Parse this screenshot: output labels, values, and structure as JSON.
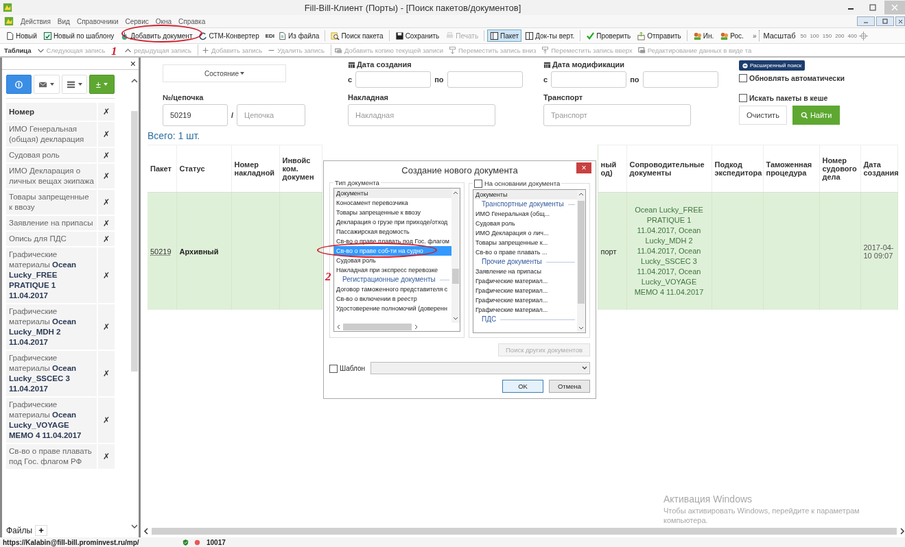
{
  "window": {
    "title": "Fill-Bill-Клиент (Порты) - [Поиск пакетов/документов]"
  },
  "menu": [
    "Действия",
    "Вид",
    "Справочники",
    "Сервис",
    "Окна",
    "Справка"
  ],
  "toolbar": [
    {
      "kind": "button",
      "label": "Новый",
      "disabled": false,
      "selected": false
    },
    {
      "kind": "button",
      "label": "Новый по шаблону",
      "disabled": false,
      "selected": false
    },
    {
      "kind": "button",
      "label": "Добавить документ",
      "disabled": false,
      "selected": false
    },
    {
      "kind": "button",
      "label": "СТМ-Конвертер",
      "disabled": false,
      "selected": false
    },
    {
      "kind": "button",
      "badge": "EDI",
      "label": "Из файла",
      "disabled": false,
      "selected": false
    },
    {
      "kind": "separator"
    },
    {
      "kind": "button",
      "label": "Поиск пакета",
      "disabled": false,
      "selected": false
    },
    {
      "kind": "separator"
    },
    {
      "kind": "button",
      "label": "Сохранить",
      "disabled": false,
      "selected": false
    },
    {
      "kind": "button",
      "label": "Печать",
      "disabled": true,
      "selected": false
    },
    {
      "kind": "separator"
    },
    {
      "kind": "button",
      "label": "Пакет",
      "disabled": false,
      "selected": true
    },
    {
      "kind": "button",
      "label": "Док-ты верт.",
      "disabled": false,
      "selected": false
    },
    {
      "kind": "separator"
    },
    {
      "kind": "button",
      "label": "Проверить",
      "disabled": false,
      "selected": false
    },
    {
      "kind": "button",
      "label": "Отправить",
      "disabled": false,
      "selected": false
    },
    {
      "kind": "separator"
    },
    {
      "kind": "button",
      "label": "Ин.",
      "disabled": false,
      "selected": false
    },
    {
      "kind": "button",
      "label": "Рос.",
      "disabled": false,
      "selected": false
    }
  ],
  "toolbar_overflow": "»",
  "zoom": {
    "label": "Масштаб",
    "steps": [
      "50",
      "100",
      "150",
      "200",
      "400"
    ]
  },
  "table_toolbar": [
    {
      "label": "Таблица"
    },
    {
      "label": "Следующая запись",
      "disabled": true
    },
    {
      "label": "редыдущая запись",
      "disabled": true
    },
    {
      "kind": "separator"
    },
    {
      "label": "Добавить запись",
      "disabled": true
    },
    {
      "label": "Удалить запись",
      "disabled": true
    },
    {
      "kind": "separator"
    },
    {
      "label": "Добавить копию текущей записи",
      "disabled": true
    },
    {
      "label": "Переместить запись вниз",
      "disabled": true
    },
    {
      "label": "Переместить запись вверх",
      "disabled": true
    },
    {
      "label": "Редактирование данных в виде та",
      "disabled": true
    }
  ],
  "sidebar": {
    "close": "×",
    "buttons": [
      {
        "kind": "status",
        "selected": true
      },
      {
        "kind": "mail",
        "selected": false
      },
      {
        "kind": "list",
        "selected": false
      },
      {
        "kind": "add",
        "label": "±",
        "selected": false
      }
    ],
    "header": {
      "label": "Номер",
      "remove": "✗"
    },
    "items": [
      {
        "text": "ИМО Генеральная (общая) декларация",
        "remove": "✗"
      },
      {
        "text": "Судовая роль",
        "remove": "✗"
      },
      {
        "text": "ИМО Декларация о личных вещах экипажа",
        "remove": "✗"
      },
      {
        "text": "Товары запрещенные к ввозу",
        "remove": "✗"
      },
      {
        "text": "Заявление на припасы",
        "remove": "✗"
      },
      {
        "text": "Опись для ПДС",
        "remove": "✗"
      },
      {
        "text": "Графические материалы **Ocean Lucky_FREE PRATIQUE 1 11.04.2017**",
        "remove": "✗"
      },
      {
        "text": "Графические материалы **Ocean Lucky_MDH 2 11.04.2017**",
        "remove": "✗"
      },
      {
        "text": "Графические материалы **Ocean Lucky_SSCEC 3 11.04.2017**",
        "remove": "✗"
      },
      {
        "text": "Графические материалы **Ocean Lucky_VOYAGE MEMO 4 11.04.2017**",
        "remove": "✗"
      },
      {
        "text": "Св-во о праве плавать под Гос. флагом РФ",
        "remove": "✗"
      }
    ],
    "files": {
      "label": "Файлы",
      "add": "+"
    }
  },
  "filter": {
    "state_button": "Состояние",
    "created": {
      "label": "Дата создания",
      "from": "с",
      "to": "по"
    },
    "modified": {
      "label": "Дата модификации",
      "from": "с",
      "to": "по"
    },
    "advanced_search": "Расширенный поиск",
    "auto_refresh": {
      "label": "Обновлять автоматически",
      "checked": false
    },
    "search_cache": {
      "label": "Искать пакеты в кеше",
      "checked": false
    },
    "chain": {
      "label": "№/цепочка",
      "number": "50219",
      "separator": "/",
      "placeholder": "Цепочка"
    },
    "waybill": {
      "label": "Накладная",
      "placeholder": "Накладная"
    },
    "transport": {
      "label": "Транспорт",
      "placeholder": "Транспорт"
    },
    "clear": "Очистить",
    "find": "Найти"
  },
  "total": "Всего: 1 шт.",
  "table": {
    "columns": [
      "Пакет",
      "Статус",
      "Номер накладной",
      "Инвойс ком. докумен",
      "ный од)",
      "Сопроводительные документы",
      "Подкод экспедитора",
      "Таможенная процедура",
      "Номер судового дела",
      "Дата создания"
    ],
    "rows": [
      {
        "package": "50219",
        "status": "Архивный",
        "column_5": "порт",
        "documents": "Ocean Lucky_FREE PRATIQUE 1 11.04.2017, Ocean Lucky_MDH 2 11.04.2017, Ocean Lucky_SSCEC 3 11.04.2017, Ocean Lucky_VOYAGE MEMO 4 11.04.2017",
        "created": "2017-04-10 09:07"
      }
    ]
  },
  "dialog": {
    "title": "Создание нового документа",
    "close": "×",
    "type_group": {
      "label": "Тип документа",
      "items": [
        {
          "kind": "header",
          "text": "Документы",
          "selected": false
        },
        {
          "kind": "item",
          "text": "Коносамент перевозчика",
          "selected": false
        },
        {
          "kind": "item",
          "text": "Товары запрещенные к ввозу",
          "selected": false
        },
        {
          "kind": "item",
          "text": "Декларация о грузе при приходе/отход",
          "selected": false
        },
        {
          "kind": "item",
          "text": "Пассажирская ведомость",
          "selected": false
        },
        {
          "kind": "item",
          "text": "Св-во о праве плавать под Гос. флагом",
          "selected": false
        },
        {
          "kind": "item",
          "text": "Св-во о праве соб-ти на судно",
          "selected": true
        },
        {
          "kind": "item",
          "text": "Судовая роль",
          "selected": false
        },
        {
          "kind": "item",
          "text": "Накладная при экспресс перевозке",
          "selected": false
        },
        {
          "kind": "group",
          "text": "Регистрационные документы",
          "selected": false
        },
        {
          "kind": "item",
          "text": "Договор таможенного представителя с",
          "selected": false
        },
        {
          "kind": "item",
          "text": "Св-во о включении в реестр",
          "selected": false
        },
        {
          "kind": "item",
          "text": "Удостоверение полномочий (доверенн",
          "selected": false
        }
      ]
    },
    "based_on": {
      "label": "На основании документа",
      "checked": false,
      "items": [
        {
          "kind": "header",
          "text": "Документы",
          "selected": false
        },
        {
          "kind": "group",
          "text": "Транспортные документы",
          "selected": false
        },
        {
          "kind": "item",
          "text": "ИМО Генеральная (общ...",
          "selected": false
        },
        {
          "kind": "item",
          "text": "Судовая роль",
          "selected": false
        },
        {
          "kind": "item",
          "text": "ИМО Декларация о лич...",
          "selected": false
        },
        {
          "kind": "item",
          "text": "Товары запрещенные к...",
          "selected": false
        },
        {
          "kind": "item",
          "text": "Св-во о праве плавать ...",
          "selected": false
        },
        {
          "kind": "group",
          "text": "Прочие документы",
          "selected": false
        },
        {
          "kind": "item",
          "text": "Заявление на припасы",
          "selected": false
        },
        {
          "kind": "item",
          "text": "Графические материал...",
          "selected": false
        },
        {
          "kind": "item",
          "text": "Графические материал...",
          "selected": false
        },
        {
          "kind": "item",
          "text": "Графические материал...",
          "selected": false
        },
        {
          "kind": "item",
          "text": "Графические материал...",
          "selected": false
        },
        {
          "kind": "group",
          "text": "ПДС",
          "selected": false
        }
      ]
    },
    "search_other": {
      "label": "Поиск других документов",
      "disabled": true
    },
    "template": {
      "label": "Шаблон",
      "checked": false
    },
    "ok": "OK",
    "cancel": "Отмена"
  },
  "annotations": [
    {
      "number": "1"
    },
    {
      "number": "2"
    }
  ],
  "os_notice": {
    "title": "Активация Windows",
    "text": "Чтобы активировать Windows, перейдите к параметрам компьютера."
  },
  "status_bar": {
    "url": "https://Kalabin@fill-bill.prominvest.ru/mp/",
    "count": "10017"
  }
}
